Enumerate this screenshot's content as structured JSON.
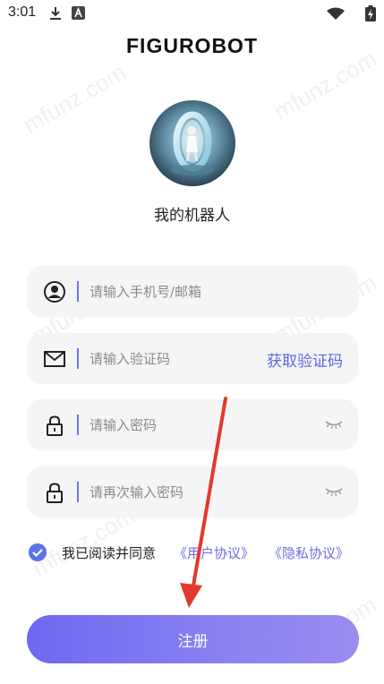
{
  "status_bar": {
    "time": "3:01",
    "icons": [
      "download-icon",
      "a-notification-icon",
      "wifi-icon",
      "battery-charging-icon"
    ]
  },
  "app": {
    "logo_text": "FIGUROBOT",
    "username": "我的机器人"
  },
  "form": {
    "phone_placeholder": "请输入手机号/邮箱",
    "code_placeholder": "请输入验证码",
    "get_code_label": "获取验证码",
    "password_placeholder": "请输入密码",
    "confirm_password_placeholder": "请再次输入密码"
  },
  "agreement": {
    "checked": true,
    "text": "我已阅读并同意",
    "user_agreement": "《用户协议》",
    "privacy_agreement": "《隐私协议》"
  },
  "register_label": "注册",
  "watermark_text": "mfunz.com",
  "colors": {
    "accent": "#6163e6",
    "divider": "#6d74e8",
    "checkbox": "#5a74ea",
    "button_start": "#6e68f1",
    "button_end": "#9a8cf0",
    "arrow": "#e2392d"
  }
}
